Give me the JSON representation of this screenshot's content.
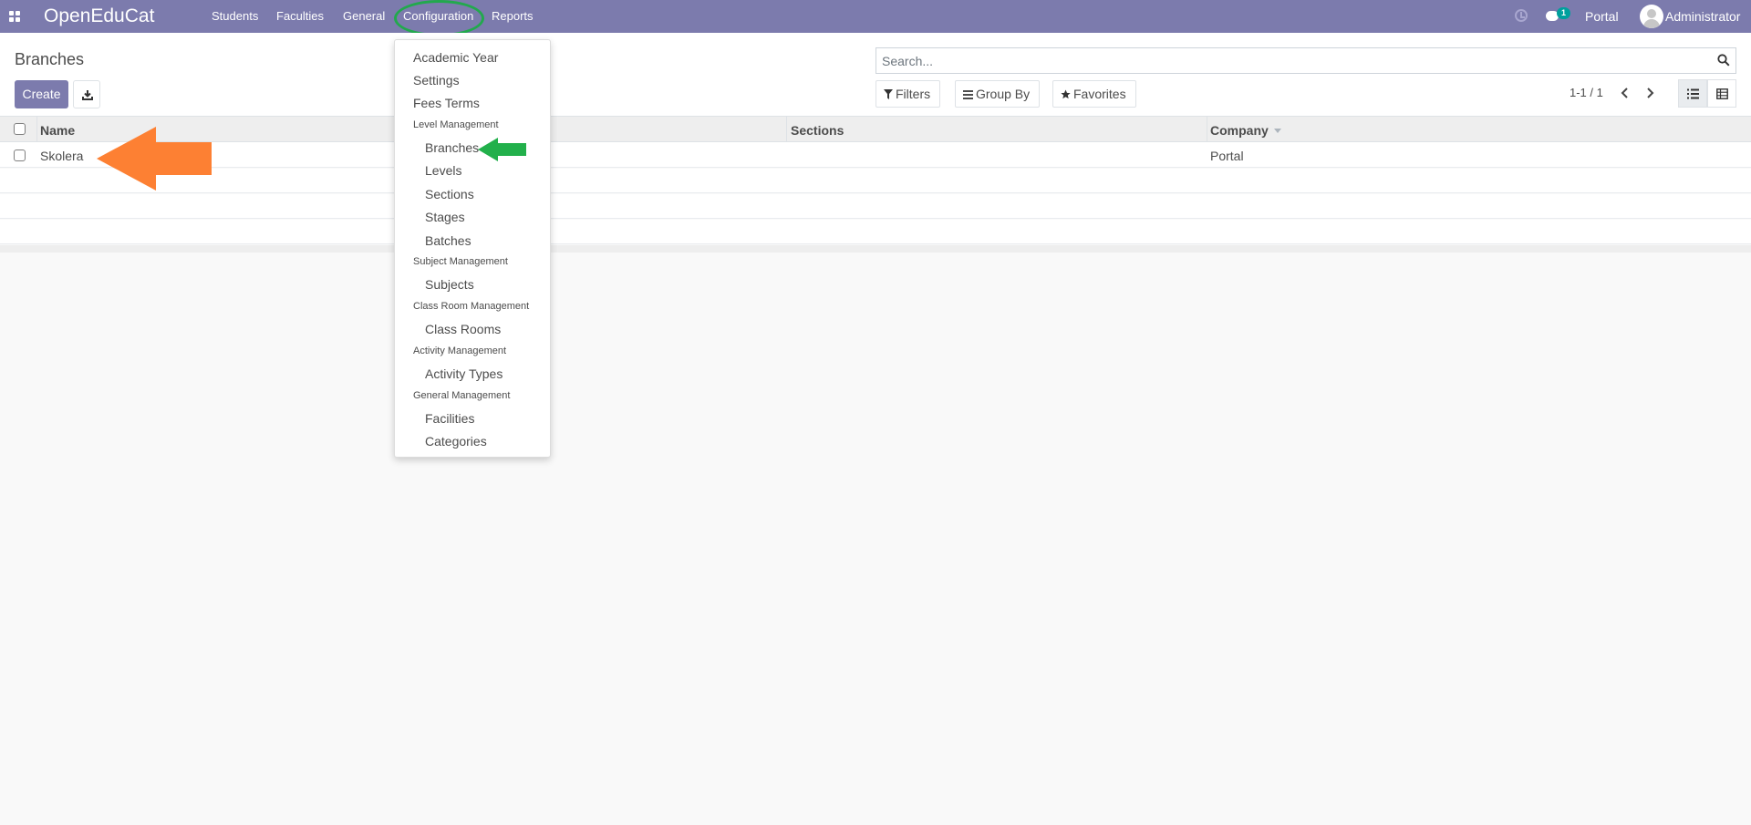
{
  "navbar": {
    "brand": "OpenEduCat",
    "menu": [
      "Students",
      "Faculties",
      "General",
      "Configuration",
      "Reports"
    ],
    "chat_badge": "1",
    "company": "Portal",
    "user": "Administrator"
  },
  "control_panel": {
    "title": "Branches",
    "create_label": "Create",
    "search_placeholder": "Search...",
    "filters_label": "Filters",
    "group_by_label": "Group By",
    "favorites_label": "Favorites",
    "pager": "1-1 / 1"
  },
  "table": {
    "columns": [
      "Name",
      "Sections",
      "Company"
    ],
    "rows": [
      {
        "name": "Skolera",
        "sections": "",
        "company": "Portal"
      }
    ]
  },
  "dropdown": {
    "items": [
      {
        "kind": "item",
        "label": "Academic Year"
      },
      {
        "kind": "item",
        "label": "Settings"
      },
      {
        "kind": "item",
        "label": "Fees Terms"
      },
      {
        "kind": "header",
        "label": "Level Management"
      },
      {
        "kind": "sub",
        "label": "Branches"
      },
      {
        "kind": "sub",
        "label": "Levels"
      },
      {
        "kind": "sub",
        "label": "Sections"
      },
      {
        "kind": "sub",
        "label": "Stages"
      },
      {
        "kind": "sub",
        "label": "Batches"
      },
      {
        "kind": "header",
        "label": "Subject Management"
      },
      {
        "kind": "sub",
        "label": "Subjects"
      },
      {
        "kind": "header",
        "label": "Class Room Management"
      },
      {
        "kind": "sub",
        "label": "Class Rooms"
      },
      {
        "kind": "header",
        "label": "Activity Management"
      },
      {
        "kind": "sub",
        "label": "Activity Types"
      },
      {
        "kind": "header",
        "label": "General Management"
      },
      {
        "kind": "sub",
        "label": "Facilities"
      },
      {
        "kind": "sub",
        "label": "Categories"
      }
    ]
  },
  "colors": {
    "navbar": "#7c7bad",
    "primary_button": "#7c7bad",
    "badge": "#00a09d",
    "highlight_green": "#22a94d",
    "annotation_orange": "#fd8033",
    "annotation_green": "#22b04b"
  }
}
